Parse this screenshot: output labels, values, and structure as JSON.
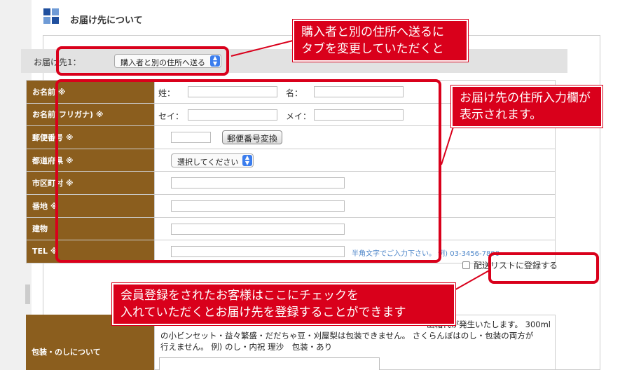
{
  "section": {
    "title": "お届け先について"
  },
  "destination": {
    "label": "お届け先1：",
    "selected": "購入者と別の住所へ送る"
  },
  "form": {
    "rows": [
      {
        "label": "お名前 ※"
      },
      {
        "label": "お名前(フリガナ) ※"
      },
      {
        "label": "郵便番号 ※"
      },
      {
        "label": "都道府県 ※"
      },
      {
        "label": "市区町村 ※"
      },
      {
        "label": "番地 ※"
      },
      {
        "label": "建物"
      },
      {
        "label": "TEL ※"
      }
    ],
    "sei_label": "姓：",
    "mei_label": "名：",
    "sei_kana_label": "セイ：",
    "mei_kana_label": "メイ：",
    "zip_button": "郵便番号変換",
    "pref_select": "選択してください",
    "tel_hint": "半角文字でご入力下さい。 例) 03-3456-7890"
  },
  "register": {
    "label": "配送リストに登録する"
  },
  "wrapping": {
    "label": "包装・のしについて",
    "text_line1": "函箱代が発生いたします。 300ml",
    "text_line2": "の小ビンセット・益々繁盛・だだちゃ豆・刈屋梨は包装できません。 さくらんぼはのし・包装の両方が",
    "text_line3": "行えません。 例) のし・内祝 理沙　包装・あり"
  },
  "callouts": {
    "tab": {
      "line1": "購入者と別の住所へ送るに",
      "line2": "タブを変更していただくと"
    },
    "form": {
      "line1": "お届け先の住所入力欄が",
      "line2": "表示されます。"
    },
    "check": {
      "line1": "会員登録をされたお客様はここにチェックを",
      "line2": "入れていただくとお届け先を登録することができます"
    }
  },
  "colors": {
    "accent": "#d9001b",
    "label_bg": "#8b5e1e",
    "icon_blue": "#1f4f9e",
    "icon_light": "#6f9bd6"
  }
}
